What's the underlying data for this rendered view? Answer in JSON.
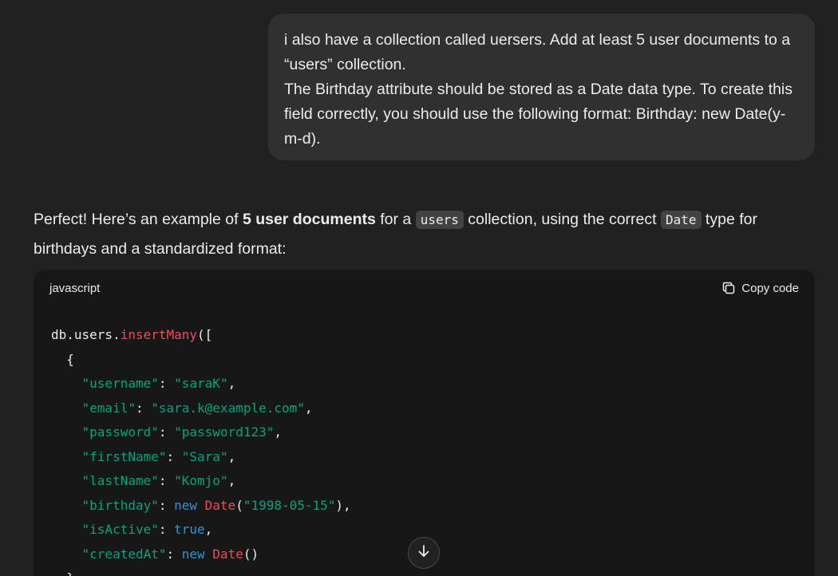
{
  "user_message": {
    "line1": "i also have a collection called uersers. Add at least 5 user documents to a “users” collection.",
    "line2": "The Birthday attribute should be stored as a Date data type. To create this field correctly, you should use the following format: Birthday: new Date(y-m-d)."
  },
  "assistant": {
    "intro_part1": "Perfect! Here’s an example of ",
    "intro_bold": "5 user documents",
    "intro_part2": " for a ",
    "intro_code1": "users",
    "intro_part3": " collection, using the correct ",
    "intro_code2": "Date",
    "intro_part4": " type for birthdays and a standardized format:"
  },
  "code_block": {
    "language": "javascript",
    "copy_label": "Copy code",
    "lines": [
      [
        {
          "t": "db.users.",
          "c": "plain"
        },
        {
          "t": "insertMany",
          "c": "fn"
        },
        {
          "t": "([",
          "c": "plain"
        }
      ],
      [
        {
          "t": "  {",
          "c": "plain"
        }
      ],
      [
        {
          "t": "    ",
          "c": "plain"
        },
        {
          "t": "\"username\"",
          "c": "str"
        },
        {
          "t": ": ",
          "c": "plain"
        },
        {
          "t": "\"saraK\"",
          "c": "str"
        },
        {
          "t": ",",
          "c": "plain"
        }
      ],
      [
        {
          "t": "    ",
          "c": "plain"
        },
        {
          "t": "\"email\"",
          "c": "str"
        },
        {
          "t": ": ",
          "c": "plain"
        },
        {
          "t": "\"sara.k@example.com\"",
          "c": "str"
        },
        {
          "t": ",",
          "c": "plain"
        }
      ],
      [
        {
          "t": "    ",
          "c": "plain"
        },
        {
          "t": "\"password\"",
          "c": "str"
        },
        {
          "t": ": ",
          "c": "plain"
        },
        {
          "t": "\"password123\"",
          "c": "str"
        },
        {
          "t": ",",
          "c": "plain"
        }
      ],
      [
        {
          "t": "    ",
          "c": "plain"
        },
        {
          "t": "\"firstName\"",
          "c": "str"
        },
        {
          "t": ": ",
          "c": "plain"
        },
        {
          "t": "\"Sara\"",
          "c": "str"
        },
        {
          "t": ",",
          "c": "plain"
        }
      ],
      [
        {
          "t": "    ",
          "c": "plain"
        },
        {
          "t": "\"lastName\"",
          "c": "str"
        },
        {
          "t": ": ",
          "c": "plain"
        },
        {
          "t": "\"Komjo\"",
          "c": "str"
        },
        {
          "t": ",",
          "c": "plain"
        }
      ],
      [
        {
          "t": "    ",
          "c": "plain"
        },
        {
          "t": "\"birthday\"",
          "c": "str"
        },
        {
          "t": ": ",
          "c": "plain"
        },
        {
          "t": "new ",
          "c": "kw"
        },
        {
          "t": "Date",
          "c": "fn"
        },
        {
          "t": "(",
          "c": "plain"
        },
        {
          "t": "\"1998-05-15\"",
          "c": "str"
        },
        {
          "t": "),",
          "c": "plain"
        }
      ],
      [
        {
          "t": "    ",
          "c": "plain"
        },
        {
          "t": "\"isActive\"",
          "c": "str"
        },
        {
          "t": ": ",
          "c": "plain"
        },
        {
          "t": "true",
          "c": "kw"
        },
        {
          "t": ",",
          "c": "plain"
        }
      ],
      [
        {
          "t": "    ",
          "c": "plain"
        },
        {
          "t": "\"createdAt\"",
          "c": "str"
        },
        {
          "t": ": ",
          "c": "plain"
        },
        {
          "t": "new ",
          "c": "kw"
        },
        {
          "t": "Date",
          "c": "fn"
        },
        {
          "t": "()",
          "c": "plain"
        }
      ],
      [
        {
          "t": "  },",
          "c": "plain"
        }
      ]
    ]
  },
  "icons": {
    "copy": "copy-icon",
    "scroll_down": "arrow-down-icon"
  },
  "colors": {
    "background": "#212121",
    "user_bubble": "#303030",
    "code_background": "#171717",
    "token_function": "#ef4b5d",
    "token_string": "#00a67d",
    "token_keyword": "#2e95d3"
  }
}
